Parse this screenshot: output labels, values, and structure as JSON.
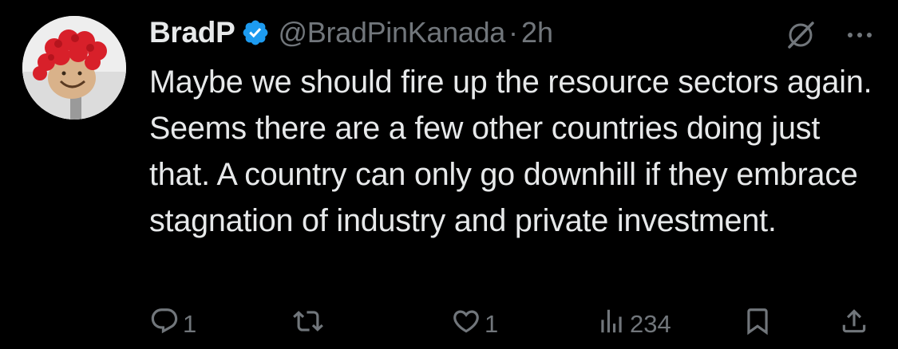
{
  "tweet": {
    "display_name": "BradP",
    "handle": "@BradPinKanada",
    "separator": "·",
    "time": "2h",
    "text": "Maybe we should fire up the resource sectors again. Seems there are a few other countries doing just that. A country can only go downhill if they embrace stagnation of industry and private investment.",
    "verified": true
  },
  "actions": {
    "replies": "1",
    "retweets": "",
    "likes": "1",
    "views": "234"
  },
  "colors": {
    "background": "#000000",
    "text": "#e7e9ea",
    "secondary": "#71767b",
    "verified": "#1d9bf0"
  },
  "icons": {
    "verified": "verified-badge-icon",
    "grok": "grok-icon",
    "more": "more-icon",
    "reply": "reply-icon",
    "retweet": "retweet-icon",
    "like": "heart-icon",
    "views": "views-icon",
    "bookmark": "bookmark-icon",
    "share": "share-icon"
  }
}
